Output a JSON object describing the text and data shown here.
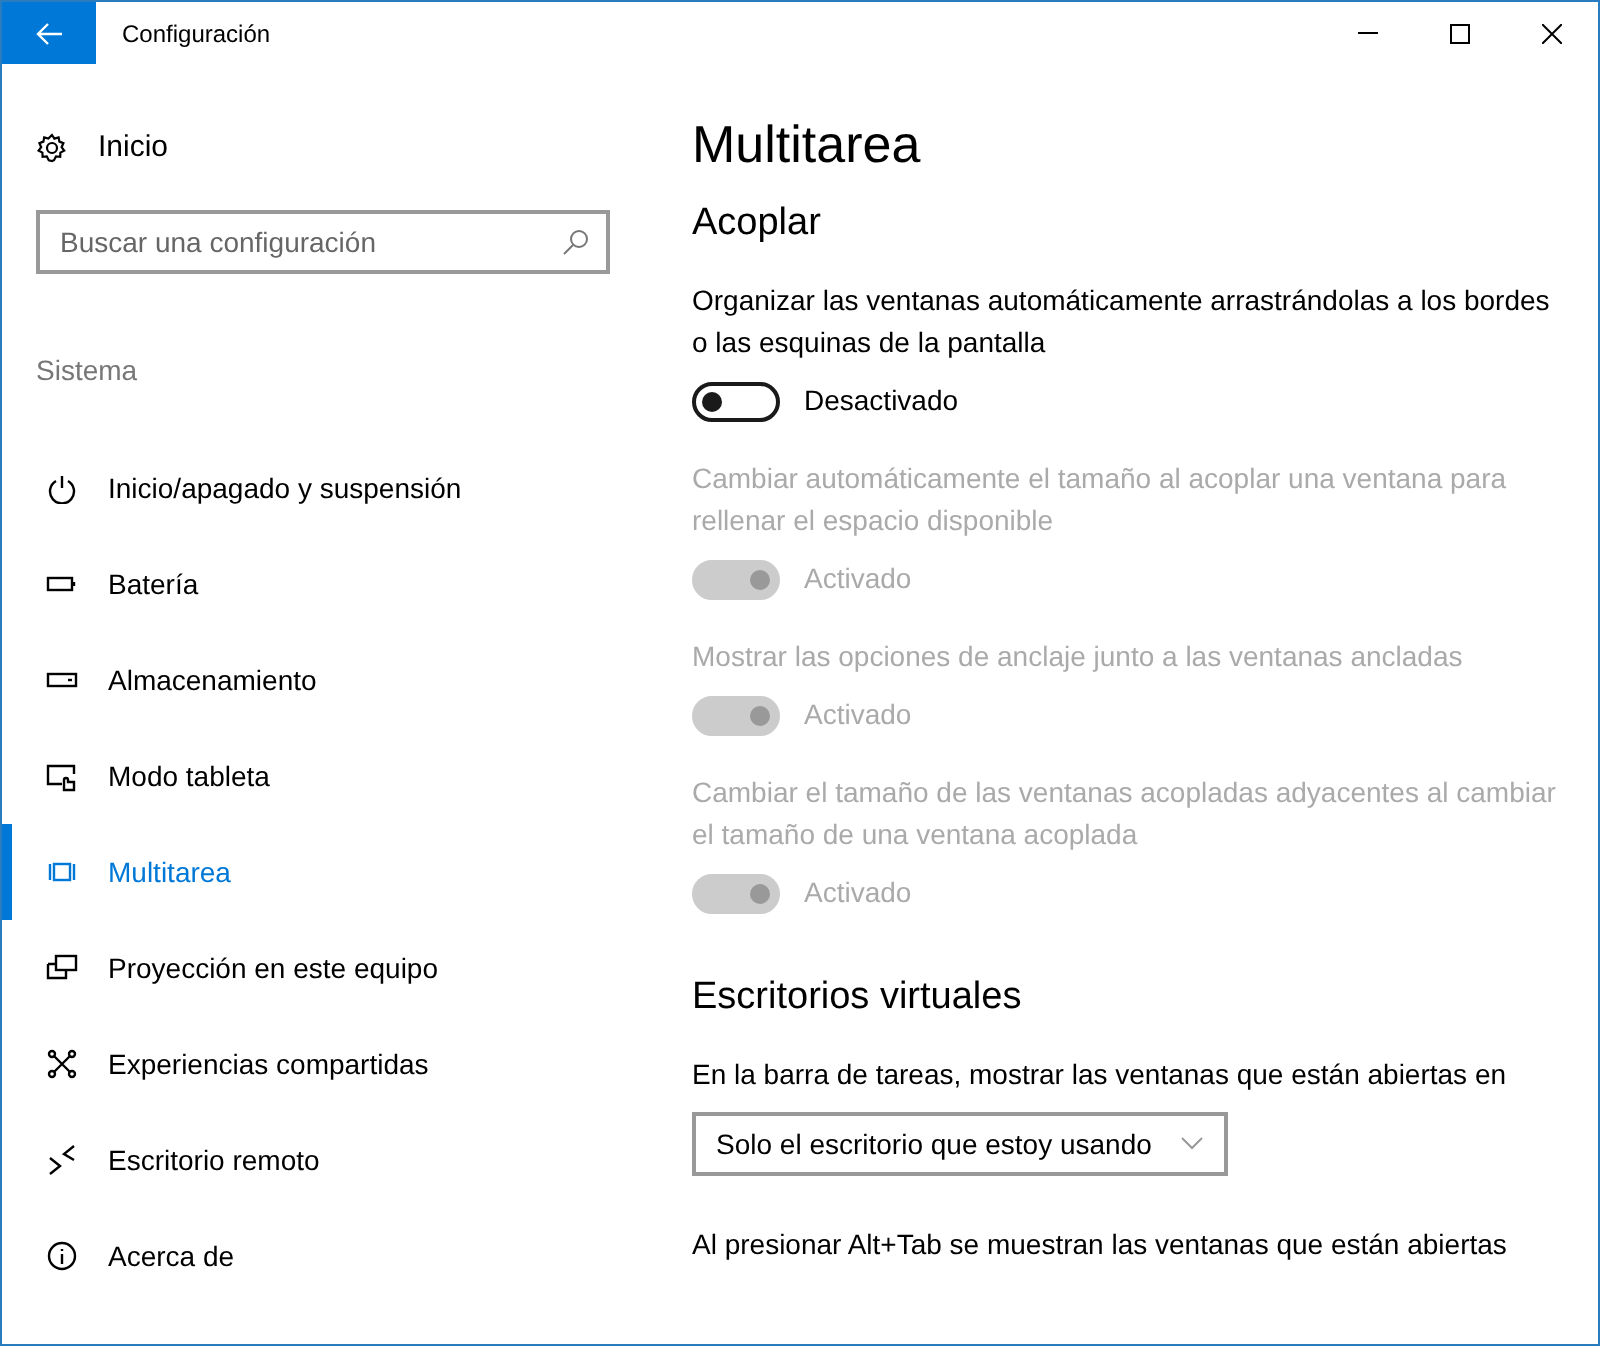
{
  "window": {
    "title": "Configuración"
  },
  "sidebar": {
    "home": "Inicio",
    "search": {
      "placeholder": "Buscar una configuración"
    },
    "group": "Sistema",
    "items": [
      {
        "label": "Inicio/apagado y suspensión",
        "kind": "power",
        "selected": false
      },
      {
        "label": "Batería",
        "kind": "battery",
        "selected": false
      },
      {
        "label": "Almacenamiento",
        "kind": "storage",
        "selected": false
      },
      {
        "label": "Modo tableta",
        "kind": "tablet",
        "selected": false
      },
      {
        "label": "Multitarea",
        "kind": "multitask",
        "selected": true
      },
      {
        "label": "Proyección en este equipo",
        "kind": "project",
        "selected": false
      },
      {
        "label": "Experiencias compartidas",
        "kind": "share",
        "selected": false
      },
      {
        "label": "Escritorio remoto",
        "kind": "remote",
        "selected": false
      },
      {
        "label": "Acerca de",
        "kind": "info",
        "selected": false
      }
    ]
  },
  "page": {
    "title": "Multitarea",
    "sections": [
      {
        "heading": "Acoplar",
        "settings": [
          {
            "kind": "toggle",
            "description": "Organizar las ventanas automáticamente arrastrándolas a los bordes o las esquinas de la pantalla",
            "on": false,
            "disabled": false,
            "state_label": "Desactivado"
          },
          {
            "kind": "toggle",
            "description": "Cambiar automáticamente el tamaño al acoplar una ventana para rellenar el espacio disponible",
            "on": true,
            "disabled": true,
            "state_label": "Activado"
          },
          {
            "kind": "toggle",
            "description": "Mostrar las opciones de anclaje junto a las ventanas ancladas",
            "on": true,
            "disabled": true,
            "state_label": "Activado"
          },
          {
            "kind": "toggle",
            "description": "Cambiar el tamaño de las ventanas acopladas adyacentes al cambiar el tamaño de una ventana acoplada",
            "on": true,
            "disabled": true,
            "state_label": "Activado"
          }
        ]
      },
      {
        "heading": "Escritorios virtuales",
        "settings": [
          {
            "kind": "dropdown",
            "description": "En la barra de tareas, mostrar las ventanas que están abiertas en",
            "value": "Solo el escritorio que estoy usando"
          },
          {
            "kind": "text",
            "description": "Al presionar Alt+Tab se muestran las ventanas que están abiertas"
          }
        ]
      }
    ]
  }
}
